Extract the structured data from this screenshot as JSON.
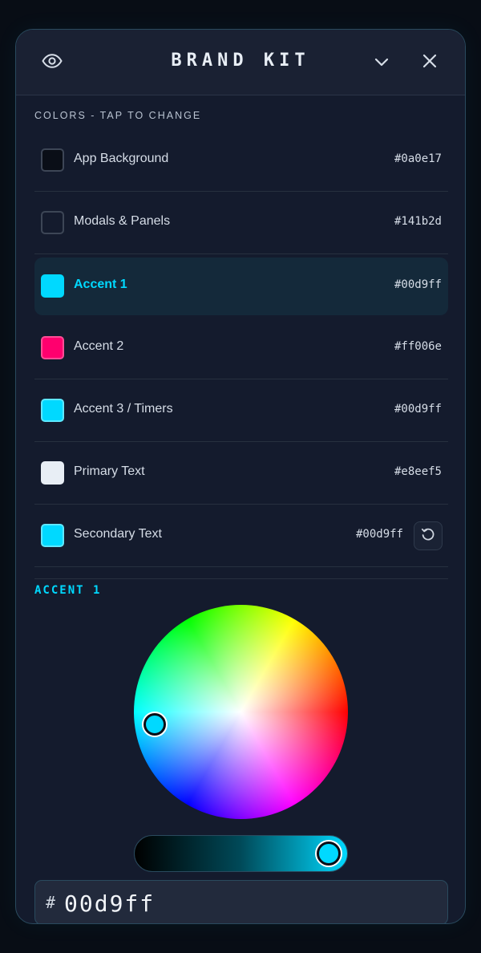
{
  "header": {
    "title": "BRAND KIT",
    "left_icon": "eye-icon",
    "collapse_icon": "chevron-down-icon",
    "close_icon": "close-icon"
  },
  "colors_section": {
    "label": "COLORS - TAP TO CHANGE",
    "items": [
      {
        "label": "App Background",
        "hex": "#0a0e17",
        "swatch": "#0a0e17",
        "active": false
      },
      {
        "label": "Modals & Panels",
        "hex": "#141b2d",
        "swatch": "#141b2d",
        "active": false
      },
      {
        "label": "Accent 1",
        "hex": "#00d9ff",
        "swatch": "#00d9ff",
        "active": true
      },
      {
        "label": "Accent 2",
        "hex": "#ff006e",
        "swatch": "#ff006e",
        "active": false
      },
      {
        "label": "Accent 3 / Timers",
        "hex": "#00d9ff",
        "swatch": "#00d9ff",
        "active": false
      },
      {
        "label": "Primary Text",
        "hex": "#e8eef5",
        "swatch": "#e8eef5",
        "active": false
      },
      {
        "label": "Secondary Text",
        "hex": "#00d9ff",
        "swatch": "#00d9ff",
        "active": false
      }
    ],
    "reset_icon": "reset-icon"
  },
  "picker": {
    "label": "ACCENT 1",
    "brightness": 1.0,
    "hash": "#",
    "hex_value": "00d9ff"
  },
  "colors": {
    "accent": "#00d9ff",
    "panel": "#141b2d",
    "background": "#0a0e17"
  }
}
